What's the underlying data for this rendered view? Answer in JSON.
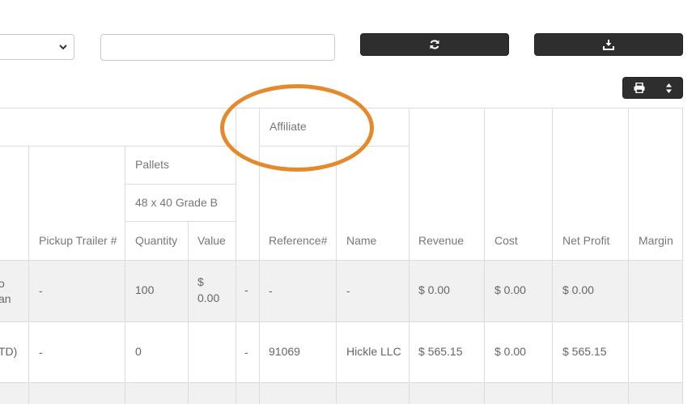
{
  "toolbar": {
    "search_value": "",
    "icons": {
      "refresh": "refresh-icon",
      "download": "download-icon",
      "print": "print-icon",
      "sort": "sort-icon",
      "select_chevron": "chevron-down-icon"
    }
  },
  "table": {
    "group_headers": {
      "affiliate": "Affiliate",
      "pallets": "Pallets",
      "pallet_grade": "48 x 40 Grade B"
    },
    "columns": {
      "pickup_trailer": "Pickup Trailer #",
      "quantity": "Quantity",
      "value": "Value",
      "reference": "Reference#",
      "name": "Name",
      "revenue": "Revenue",
      "cost": "Cost",
      "net_profit": "Net Profit",
      "margin": "Margin"
    },
    "rows": [
      {
        "partial_first_line1": "o",
        "partial_first_line2": "an",
        "pickup_trailer": "-",
        "quantity": "100",
        "value_line1": "$",
        "value_line2": "0.00",
        "gap": "-",
        "reference": "-",
        "name": "-",
        "revenue": "$ 0.00",
        "cost": "$ 0.00",
        "net_profit": "$ 0.00",
        "margin": ""
      },
      {
        "partial_first_line1": "TD)",
        "partial_first_line2": "",
        "pickup_trailer": "-",
        "quantity": "0",
        "value_line1": "",
        "value_line2": "",
        "gap": "-",
        "reference": "91069",
        "name": "Hickle LLC",
        "revenue": "$ 565.15",
        "cost": "$ 0.00",
        "net_profit": "$ 565.15",
        "margin": ""
      }
    ]
  },
  "colors": {
    "highlight": "#e58a2c",
    "button_bg": "#2e2e2e",
    "row_shade": "#f1f1f1",
    "grid_line": "#dcdcdc"
  }
}
